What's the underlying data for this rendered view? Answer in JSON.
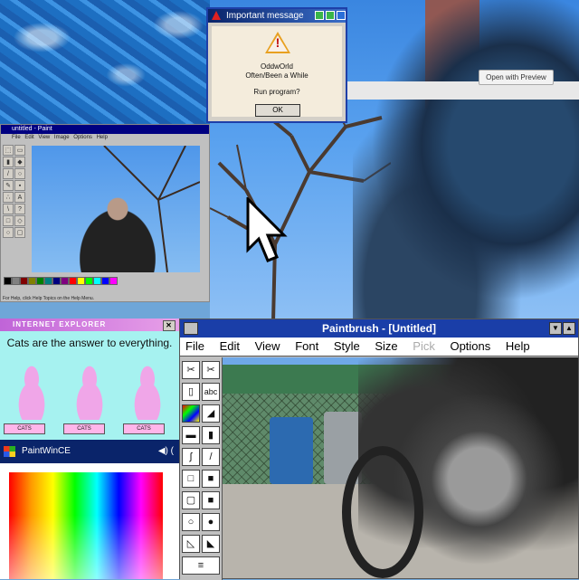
{
  "dialog": {
    "title": "Important message",
    "line1": "OddwOrld",
    "line2": "Often/Been a While",
    "line3": "Run program?",
    "ok_label": "OK"
  },
  "browser_bar": {
    "preview_label": "Open with Preview"
  },
  "paint": {
    "title": "untitled - Paint",
    "menu": "File Edit View Image Options Help",
    "status": "For Help, click Help Topics on the Help Menu."
  },
  "ie": {
    "title": "INTERNET EXPLORER",
    "close": "✕",
    "headline": "Cats are the answer to everything.",
    "cat_buttons": [
      "CATS",
      "CATS",
      "CATS"
    ]
  },
  "wince": {
    "title": "PaintWinCE",
    "speaker": "◀) ("
  },
  "paintbrush": {
    "title": "Paintbrush - [Untitled]",
    "menu": [
      "File",
      "Edit",
      "View",
      "Font",
      "Style",
      "Size",
      "Pick",
      "Options",
      "Help"
    ],
    "tool_abc": "abc"
  },
  "colors": {
    "dialog_title": "#0a246a",
    "paintbrush_title": "#1a3ea8",
    "ie_bg": "#a6f2f0",
    "cat_pink": "#f0a6e8"
  }
}
